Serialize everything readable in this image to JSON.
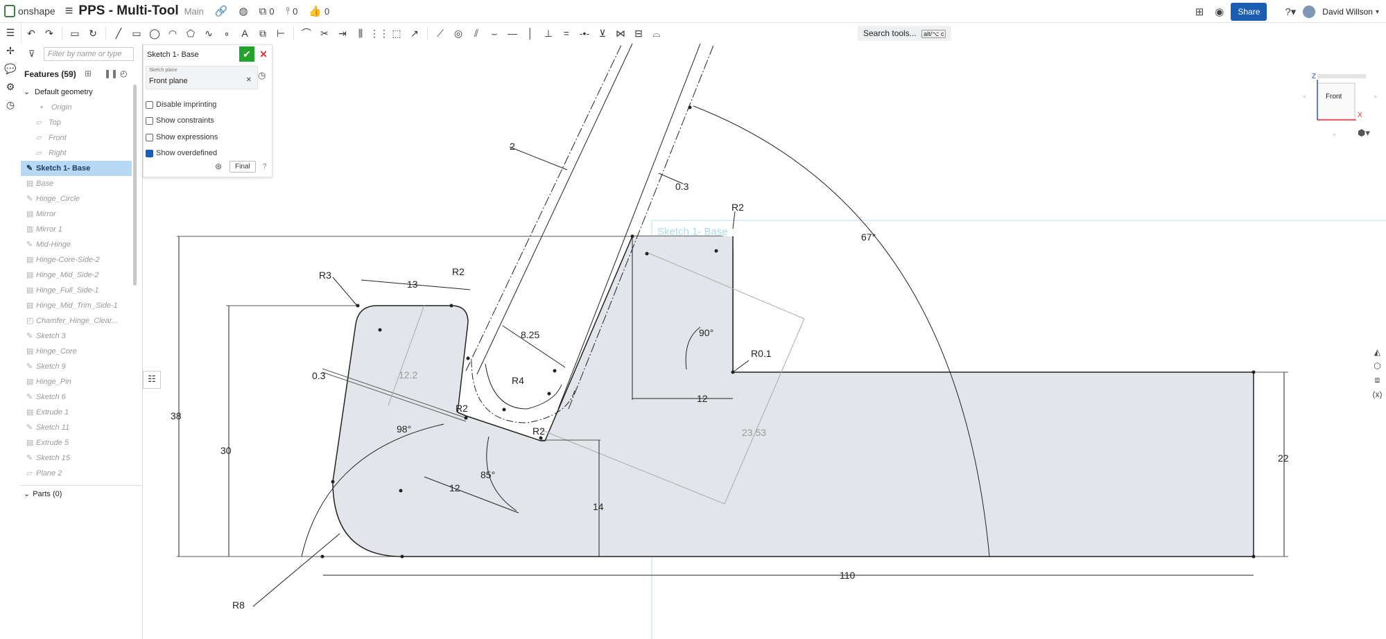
{
  "app": {
    "logo": "onshape",
    "title": "PPS - Multi-Tool",
    "branch": "Main",
    "versions_count": "0",
    "branches_count": "0",
    "likes_count": "0",
    "share_label": "Share",
    "user_name": "David Willson"
  },
  "toolbar": {
    "search_label": "Search tools...",
    "search_shortcut": "alt/⌥ c"
  },
  "features": {
    "filter_placeholder": "Filter by name or type",
    "header": "Features (59)",
    "default_geometry": "Default geometry",
    "origin": "Origin",
    "planes": [
      "Top",
      "Front",
      "Right"
    ],
    "selected": "Sketch 1- Base",
    "items": [
      "Base",
      "Hinge_Circle",
      "Mirror",
      "Mirror 1",
      "Mid-Hinge",
      "Hinge-Core-Side-2",
      "Hinge_Mid_Side-2",
      "Hinge_Full_Side-1",
      "Hinge_Mid_Trim_Side-1",
      "Chamfer_Hinge_Clear...",
      "Sketch 3",
      "Hinge_Core",
      "Sketch 9",
      "Hinge_Pin",
      "Sketch 6",
      "Extrude 1",
      "Sketch 11",
      "Extrude 5",
      "Sketch 15",
      "Plane 2"
    ],
    "parts": "Parts (0)"
  },
  "sketch_dialog": {
    "title": "Sketch 1- Base",
    "plane_caption": "Sketch plane",
    "plane_value": "Front plane",
    "options": [
      {
        "label": "Disable imprinting",
        "checked": false
      },
      {
        "label": "Show constraints",
        "checked": false
      },
      {
        "label": "Show expressions",
        "checked": false
      },
      {
        "label": "Show overdefined",
        "checked": true
      }
    ],
    "final_label": "Final"
  },
  "view_cube": {
    "face": "Front",
    "axis_z": "Z",
    "axis_x": "X"
  },
  "sketch": {
    "name_label": "Sketch 1- Base",
    "dimensions": {
      "d2": "2",
      "d03a": "0.3",
      "r2a": "R2",
      "d67": "67°",
      "r3": "R3",
      "d13": "13",
      "r2b": "R2",
      "d825": "8.25",
      "d90": "90°",
      "r01": "R0.1",
      "d122": "12.2",
      "r4": "R4",
      "d03b": "0.3",
      "r2c": "R2",
      "r2d": "R2",
      "d12a": "12",
      "d2353": "23.53",
      "d38": "38",
      "d98": "98°",
      "d30": "30",
      "d85": "85°",
      "d12b": "12",
      "d14": "14",
      "d22": "22",
      "r8": "R8",
      "d110": "110"
    }
  }
}
